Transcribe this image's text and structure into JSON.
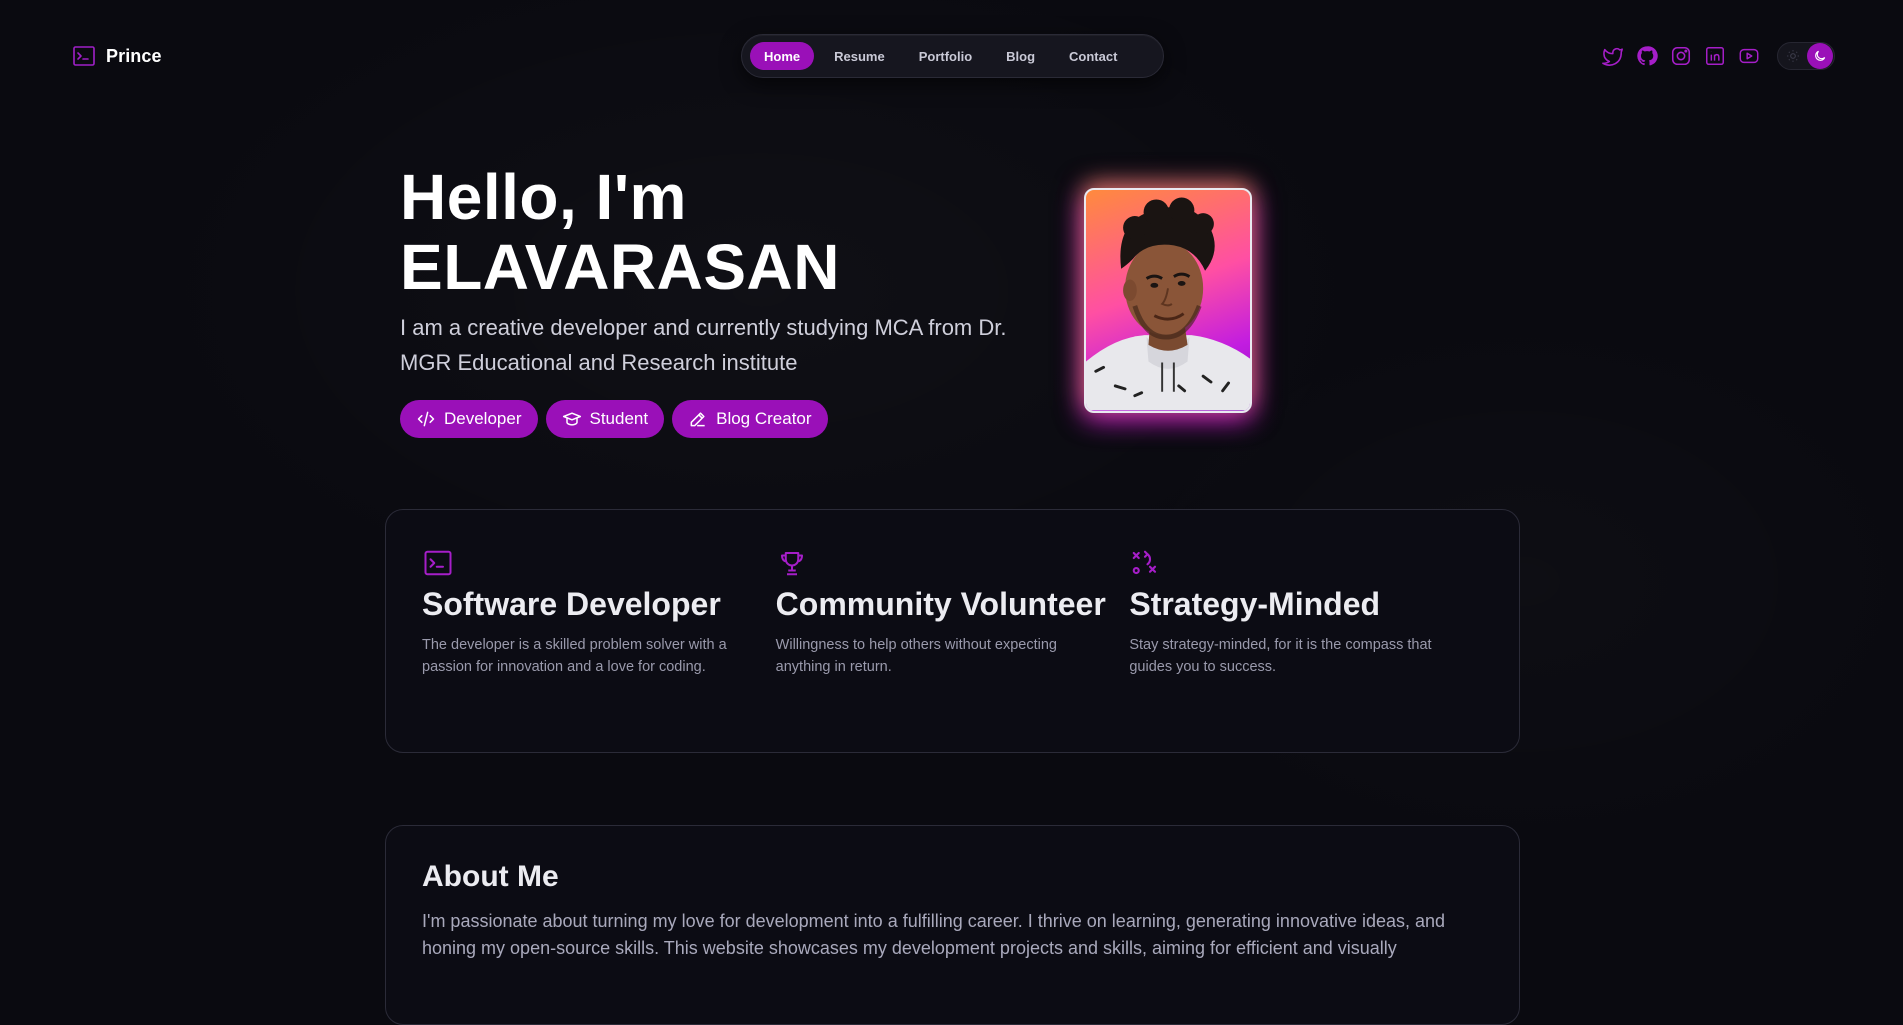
{
  "brand": {
    "name": "Prince",
    "icon": "terminal-icon"
  },
  "nav": {
    "items": [
      {
        "label": "Home",
        "active": true
      },
      {
        "label": "Resume",
        "active": false
      },
      {
        "label": "Portfolio",
        "active": false
      },
      {
        "label": "Blog",
        "active": false
      },
      {
        "label": "Contact",
        "active": false
      }
    ]
  },
  "socials": [
    "twitter-icon",
    "github-icon",
    "instagram-icon",
    "linkedin-icon",
    "youtube-icon"
  ],
  "theme": {
    "mode": "dark"
  },
  "hero": {
    "greeting": "Hello, I'm",
    "name": "ELAVARASAN",
    "subtitle": "I am a creative developer and currently studying MCA from Dr. MGR Educational and Research institute",
    "tags": [
      {
        "label": "Developer",
        "icon": "code-icon"
      },
      {
        "label": "Student",
        "icon": "graduation-cap-icon"
      },
      {
        "label": "Blog Creator",
        "icon": "pen-icon"
      }
    ]
  },
  "skills": [
    {
      "title": "Software Developer",
      "text": "The developer is a skilled problem solver with a passion for innovation and a love for coding.",
      "icon": "terminal-icon"
    },
    {
      "title": "Community Volunteer",
      "text": "Willingness to help others without expecting anything in return.",
      "icon": "trophy-icon"
    },
    {
      "title": "Strategy-Minded",
      "text": "Stay strategy-minded, for it is the compass that guides you to success.",
      "icon": "strategy-icon"
    }
  ],
  "about": {
    "title": "About Me",
    "text": "I'm passionate about turning my love for development into a fulfilling career. I thrive on learning, generating innovative ideas, and honing my open-source skills. This website showcases my development projects and skills, aiming for efficient and visually"
  },
  "colors": {
    "accent": "#9a10b8",
    "background": "#0a0a10"
  }
}
